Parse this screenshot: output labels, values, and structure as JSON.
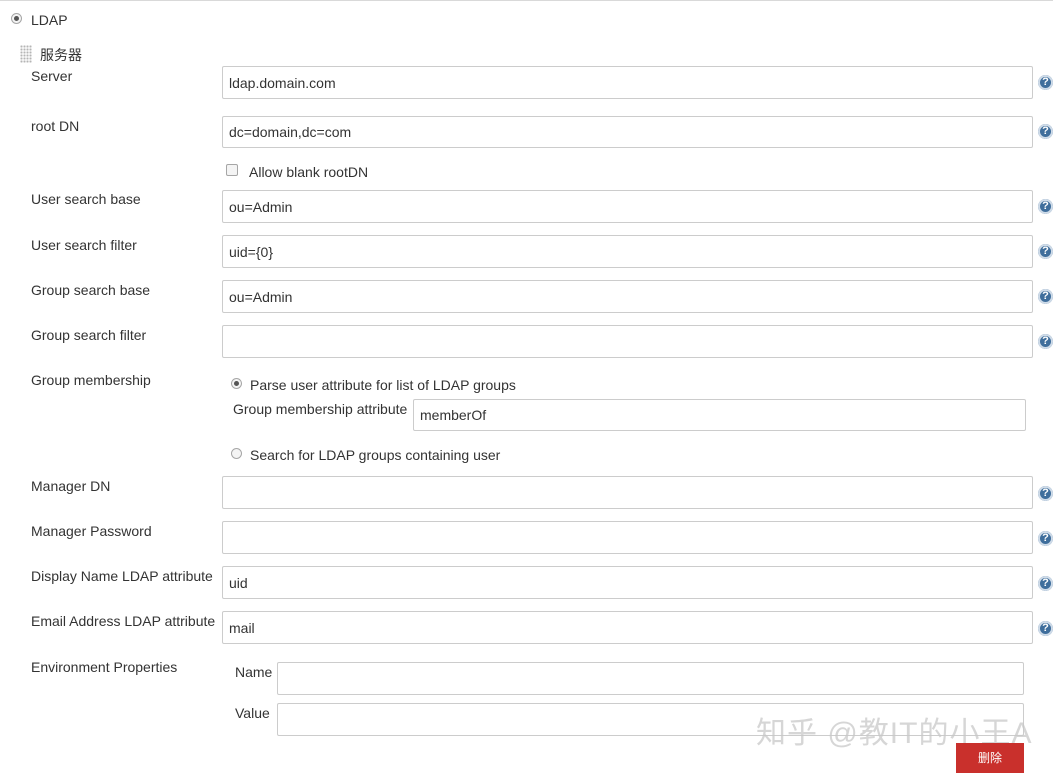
{
  "realm": {
    "option_label": "LDAP",
    "selected": true
  },
  "section": {
    "title": "服务器"
  },
  "fields": {
    "server": {
      "label": "Server",
      "value": "ldap.domain.com"
    },
    "root_dn": {
      "label": "root DN",
      "value": "dc=domain,dc=com"
    },
    "allow_blank_rootdn": {
      "label": "Allow blank rootDN",
      "checked": false
    },
    "user_search_base": {
      "label": "User search base",
      "value": "ou=Admin"
    },
    "user_search_filter": {
      "label": "User search filter",
      "value": "uid={0}"
    },
    "group_search_base": {
      "label": "Group search base",
      "value": "ou=Admin"
    },
    "group_search_filter": {
      "label": "Group search filter",
      "value": ""
    },
    "group_membership": {
      "label": "Group membership",
      "option_parse": "Parse user attribute for list of LDAP groups",
      "attribute_label": "Group membership attribute",
      "attribute_value": "memberOf",
      "option_search": "Search for LDAP groups containing user",
      "selected": "parse"
    },
    "manager_dn": {
      "label": "Manager DN",
      "value": ""
    },
    "manager_password": {
      "label": "Manager Password",
      "value": ""
    },
    "display_name_attr": {
      "label": "Display Name LDAP attribute",
      "value": "uid"
    },
    "email_attr": {
      "label": "Email Address LDAP attribute",
      "value": "mail"
    },
    "environment_properties": {
      "label": "Environment Properties",
      "name_label": "Name",
      "name_value": "",
      "value_label": "Value",
      "value_value": ""
    }
  },
  "help_icon": {
    "glyph": "?"
  },
  "delete_button": {
    "label": "删除"
  },
  "watermark": {
    "text": "知乎 @教IT的小王A"
  },
  "colors": {
    "help": "#3f6e9c",
    "delete": "#c9302c",
    "border": "#cccccc"
  }
}
